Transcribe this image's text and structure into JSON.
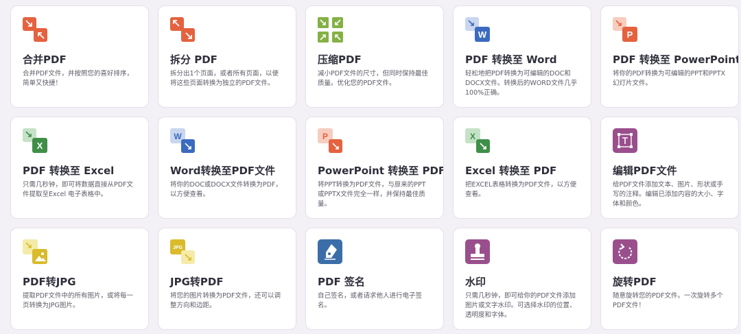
{
  "tools": [
    {
      "title": "合并PDF",
      "desc": "合并PDF文件，并按照您的喜好排序，简单又快捷！",
      "icon": "merge-pdf-icon",
      "color": "#e5623f"
    },
    {
      "title": "拆分 PDF",
      "desc": "拆分出1个页面，或者所有页面，以便将这些页面转换为独立的PDF文件。",
      "icon": "split-pdf-icon",
      "color": "#e5623f"
    },
    {
      "title": "压缩PDF",
      "desc": "减小PDF文件的尺寸，但同时保持最佳质量。优化您的PDF文件。",
      "icon": "compress-pdf-icon",
      "color": "#84b145"
    },
    {
      "title": "PDF 转换至 Word",
      "desc": "轻松地把PDF转换为可编辑的DOC和DOCX文件。转换后的WORD文件几乎100%正确。",
      "icon": "pdf-to-word-icon",
      "color": "#3b6bbf",
      "letter": "W"
    },
    {
      "title": "PDF 转换至 PowerPoint",
      "desc": "将你的PDF转换为可编辑的PPT和PPTX幻灯片文件。",
      "icon": "pdf-to-powerpoint-icon",
      "color": "#e5623f",
      "letter": "P"
    },
    {
      "title": "PDF 转换至 Excel",
      "desc": "只需几秒钟，即可将数据直接从PDF文件提取至Excel 电子表格中。",
      "icon": "pdf-to-excel-icon",
      "color": "#3f8f48",
      "letter": "X"
    },
    {
      "title": "Word转换至PDF文件",
      "desc": "将你的DOC或DOCX文件转换为PDF，以方便查看。",
      "icon": "word-to-pdf-icon",
      "color": "#3b6bbf",
      "letter": "W"
    },
    {
      "title": "PowerPoint 转换至 PDF",
      "desc": "将PPT转换为PDF文件，与原来的PPT或PPTX文件完全一样，并保持最佳质量。",
      "icon": "powerpoint-to-pdf-icon",
      "color": "#e5623f",
      "letter": "P"
    },
    {
      "title": "Excel 转换至 PDF",
      "desc": "把EXCEL表格转换为PDF文件，以方便查看。",
      "icon": "excel-to-pdf-icon",
      "color": "#3f8f48",
      "letter": "X"
    },
    {
      "title": "编辑PDF文件",
      "desc": "给PDF文件添加文本、图片、形状或手写的注释。编辑已添加内容的大小、字体和颜色。",
      "icon": "edit-pdf-icon",
      "color": "#9a4f8d"
    },
    {
      "title": "PDF转JPG",
      "desc": "提取PDF文件中的所有图片，或将每一页转换为JPG图片。",
      "icon": "pdf-to-jpg-icon",
      "color": "#d9bb2b"
    },
    {
      "title": "JPG转PDF",
      "desc": "将您的图片转换为PDF文件，还可以调整方向和边距。",
      "icon": "jpg-to-pdf-icon",
      "color": "#d9bb2b",
      "letter": "JPG"
    },
    {
      "title": "PDF 签名",
      "desc": "自己签名，或者请求他人进行电子签名。",
      "icon": "sign-pdf-icon",
      "color": "#3b6ea8"
    },
    {
      "title": "水印",
      "desc": "只需几秒钟，即可给你的PDF文件添加图片或文字水印。可选择水印的位置、透明度和字体。",
      "icon": "watermark-icon",
      "color": "#9a4f8d"
    },
    {
      "title": "旋转PDF",
      "desc": "随意旋转您的PDF文件。一次旋转多个PDF文件！",
      "icon": "rotate-pdf-icon",
      "color": "#9a4f8d"
    }
  ]
}
